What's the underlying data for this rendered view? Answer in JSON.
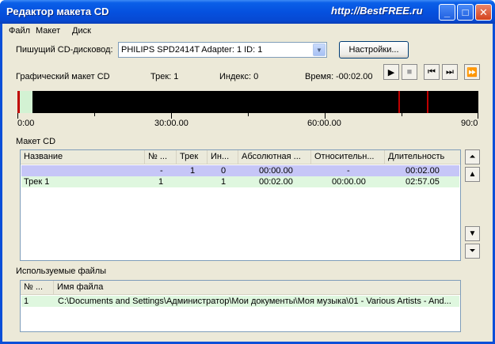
{
  "window": {
    "title": "Редактор макета CD",
    "watermark": "http://BestFREE.ru",
    "controls": {
      "minimize": "_",
      "maximize": "□",
      "close": "✕"
    }
  },
  "menu": {
    "items": [
      "Файл",
      "Макет",
      "Диск"
    ]
  },
  "drive": {
    "label": "Пишущий CD-дисковод:",
    "selected": "PHILIPS SPD2414T   Adapter: 1  ID: 1",
    "settings_button": "Настройки..."
  },
  "status": {
    "layout_label": "Графический макет CD",
    "track": "Трек: 1",
    "index": "Индекс: 0",
    "time_label": "Время:",
    "time_value": "-00:02.00"
  },
  "transport": {
    "icons": [
      "play-icon",
      "stop-icon",
      "prev-track-icon",
      "next-track-icon",
      "fast-forward-icon"
    ],
    "glyphs": [
      "▶",
      "■",
      "⏮",
      "⏭",
      "⏩"
    ]
  },
  "timeline": {
    "ticks": [
      "0:00",
      "30:00.00",
      "60:00.00",
      "90:0"
    ],
    "colors": {
      "background": "#000000",
      "lead_in": "#d3f2d3",
      "marker": "#c00000"
    }
  },
  "layout_table": {
    "label": "Макет CD",
    "columns": [
      "Название",
      "№ ...",
      "Трек",
      "Ин...",
      "Абсолютная ...",
      "Относительн...",
      "Длительность"
    ],
    "rows": [
      {
        "name": "",
        "no": "-",
        "track": "1",
        "index": "0",
        "absolute": "00:00.00",
        "relative": "-",
        "duration": "00:02.00"
      },
      {
        "name": "Трек 1",
        "no": "1",
        "track": "",
        "index": "1",
        "absolute": "00:02.00",
        "relative": "00:00.00",
        "duration": "02:57.05"
      }
    ],
    "row_colors": [
      "#c6c6f7",
      "#dff7df"
    ]
  },
  "side_buttons": {
    "icons": [
      "move-top-icon",
      "move-up-icon",
      "move-down-icon",
      "move-bottom-icon"
    ],
    "glyphs": [
      "⏶",
      "▲",
      "▼",
      "⏷"
    ]
  },
  "files_table": {
    "label": "Используемые файлы",
    "columns": [
      "№ ...",
      "Имя файла"
    ],
    "rows": [
      {
        "no": "1",
        "file": "C:\\Documents and Settings\\Администратор\\Мои документы\\Моя музыка\\01 - Various Artists - And..."
      }
    ],
    "row_color": "#dff7df"
  }
}
